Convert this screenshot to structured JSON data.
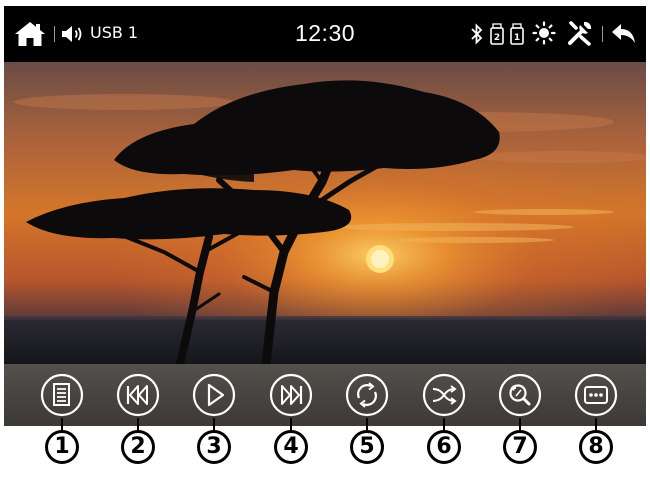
{
  "status_bar": {
    "source": "USB 1",
    "time": "12:30",
    "icons": [
      "home-icon",
      "volume-icon",
      "bluetooth-icon",
      "usb-2-icon",
      "usb-1-icon",
      "brightness-icon",
      "settings-icon",
      "back-icon"
    ]
  },
  "video": {
    "content": "sunset-savanna-acacia-trees"
  },
  "controls": [
    {
      "name": "playlist-button",
      "icon": "list-icon"
    },
    {
      "name": "previous-button",
      "icon": "skip-previous-icon"
    },
    {
      "name": "play-button",
      "icon": "play-icon"
    },
    {
      "name": "next-button",
      "icon": "skip-next-icon"
    },
    {
      "name": "repeat-button",
      "icon": "repeat-icon"
    },
    {
      "name": "shuffle-button",
      "icon": "shuffle-icon"
    },
    {
      "name": "zoom-button",
      "icon": "zoom-icon"
    },
    {
      "name": "more-button",
      "icon": "more-icon"
    }
  ],
  "callouts": [
    "1",
    "2",
    "3",
    "4",
    "5",
    "6",
    "7",
    "8"
  ]
}
